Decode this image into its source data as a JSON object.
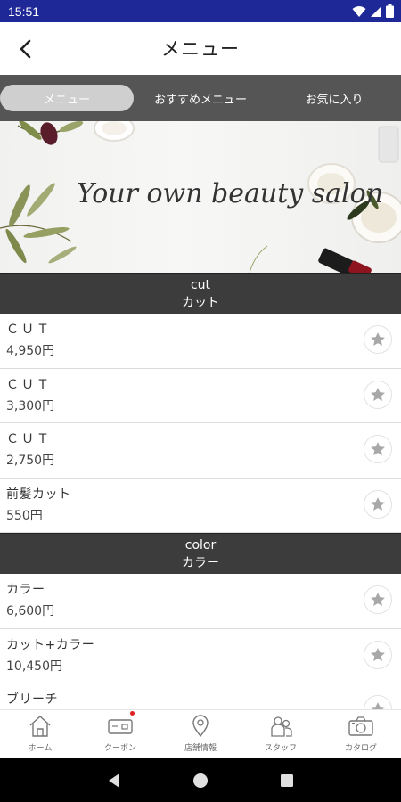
{
  "status_bar": {
    "time": "15:51"
  },
  "header": {
    "title": "メニュー"
  },
  "tabs": [
    {
      "label": "メニュー",
      "active": true
    },
    {
      "label": "おすすめメニュー",
      "active": false
    },
    {
      "label": "お気に入り",
      "active": false
    }
  ],
  "banner": {
    "tagline": "Your own beauty salon"
  },
  "sections": [
    {
      "title_en": "cut",
      "title_ja": "カット",
      "items": [
        {
          "name": "ＣＵＴ",
          "price": "4,950円"
        },
        {
          "name": "ＣＵＴ",
          "price": "3,300円"
        },
        {
          "name": "ＣＵＴ",
          "price": "2,750円"
        },
        {
          "name": "前髪カット",
          "price": "550円"
        }
      ]
    },
    {
      "title_en": "color",
      "title_ja": "カラー",
      "items": [
        {
          "name": "カラー",
          "price": "6,600円"
        },
        {
          "name": "カット+カラー",
          "price": "10,450円"
        },
        {
          "name": "ブリーチ",
          "price": ""
        }
      ]
    }
  ],
  "bottom_nav": [
    {
      "label": "ホーム",
      "icon": "home-icon"
    },
    {
      "label": "クーポン",
      "icon": "coupon-icon"
    },
    {
      "label": "店舗情報",
      "icon": "location-pin-icon"
    },
    {
      "label": "スタッフ",
      "icon": "staff-icon"
    },
    {
      "label": "カタログ",
      "icon": "camera-icon"
    }
  ],
  "colors": {
    "status_bar": "#1e2896",
    "tab_bar": "#555555",
    "section_header": "#3c3c3c",
    "notification_dot": "#e02020"
  }
}
